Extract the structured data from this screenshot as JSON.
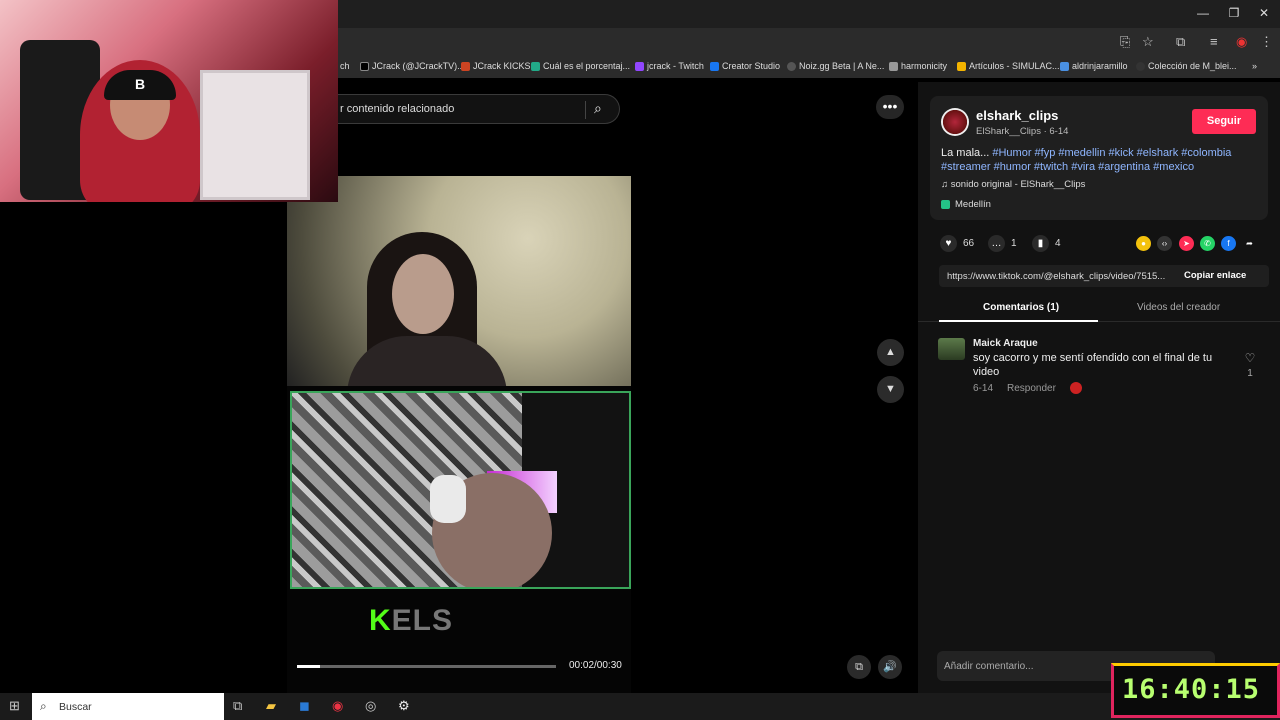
{
  "window": {
    "minimize": "—",
    "restore": "❐",
    "close": "✕"
  },
  "bookmarks": [
    {
      "label": "ch",
      "color": "#555"
    },
    {
      "label": "JCrack (@JCrackTV)...",
      "color": "#000"
    },
    {
      "label": "JCrack KICKS",
      "color": "#c42"
    },
    {
      "label": "Cuál es el porcentaj...",
      "color": "#2a8"
    },
    {
      "label": "jcrack - Twitch",
      "color": "#9146ff"
    },
    {
      "label": "Creator Studio",
      "color": "#1877f2"
    },
    {
      "label": "Noiz.gg Beta | A Ne...",
      "color": "#555"
    },
    {
      "label": "harmonicity",
      "color": "#999"
    },
    {
      "label": "Artículos - SIMULAC...",
      "color": "#f4b400"
    },
    {
      "label": "aldrinjaramillo",
      "color": "#4a90e2"
    },
    {
      "label": "Colección de M_blei...",
      "color": "#333"
    }
  ],
  "search": {
    "text": "r contenido relacionado"
  },
  "video": {
    "logo_k": "K",
    "logo_rest": "ELS",
    "time": "00:02/00:30",
    "progress": 0.09
  },
  "author": {
    "name": "elshark_clips",
    "sub": "ElShark__Clips · 6-14",
    "follow": "Seguir"
  },
  "description": {
    "lead": "La mala... ",
    "hashtags": "#Humor #fyp #medellin #kick #elshark #colombia #streamer #humor #twitch #vira #argentina #mexico",
    "sound": "sonido original - ElShark__Clips",
    "location": "Medellín"
  },
  "stats": {
    "likes": "66",
    "comments": "1",
    "saves": "4"
  },
  "url": {
    "text": "https://www.tiktok.com/@elshark_clips/video/7515...",
    "copy": "Copiar enlace"
  },
  "tabs": {
    "comments": "Comentarios (1)",
    "creator_videos": "Videos del creador"
  },
  "comment": {
    "author": "Maick Araque",
    "text": "soy cacorro y me sentí ofendido con el final de tu video",
    "date": "6-14",
    "reply": "Responder",
    "likes": "1"
  },
  "add_comment": {
    "placeholder": "Añadir comentario..."
  },
  "taskbar": {
    "search": "Buscar"
  },
  "clock": {
    "time": "16:40:15"
  },
  "colors": {
    "accent": "#fe2c55",
    "kick": "#53fc18",
    "hashtag": "#8fb6ff"
  }
}
